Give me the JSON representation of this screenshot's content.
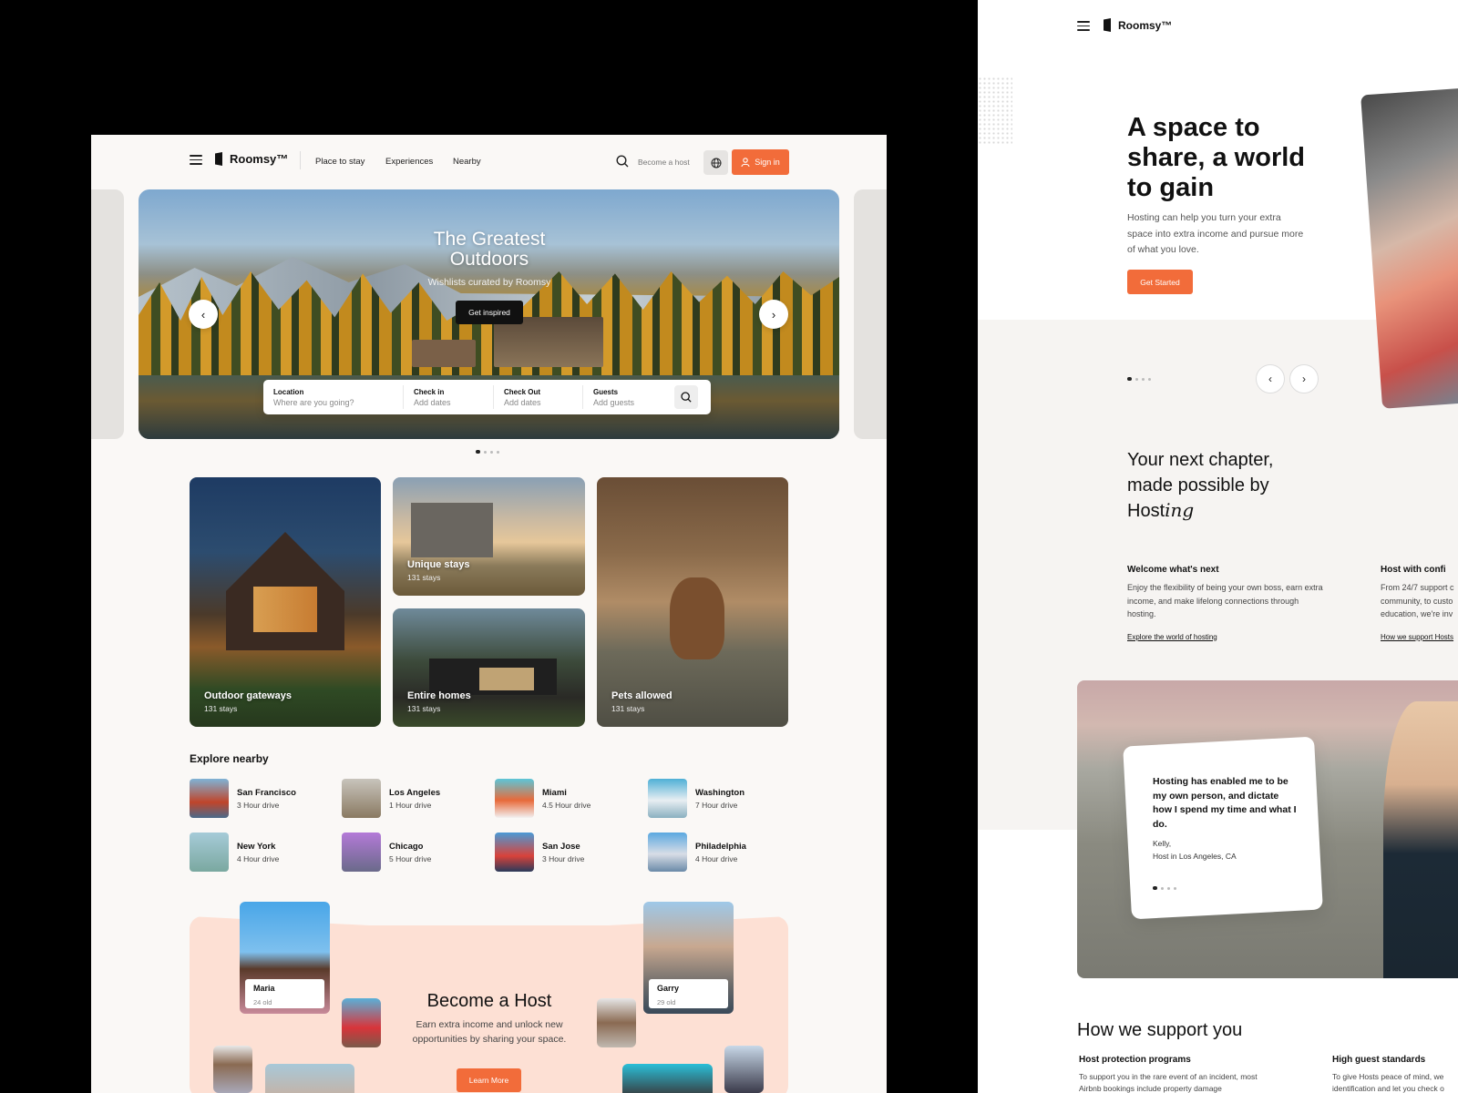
{
  "left": {
    "header": {
      "brand": "Roomsy™",
      "nav": [
        "Place to stay",
        "Experiences",
        "Nearby"
      ],
      "become_host": "Become a host",
      "sign_in": "Sign in"
    },
    "hero": {
      "title_line1": "The Greatest",
      "title_line2": "Outdoors",
      "subtitle": "Wishlists curated by Roomsy",
      "cta": "Get inspired",
      "prev_arrow": "‹",
      "next_arrow": "›",
      "search": {
        "location_label": "Location",
        "location_placeholder": "Where are you going?",
        "checkin_label": "Check in",
        "checkin_placeholder": "Add dates",
        "checkout_label": "Check Out",
        "checkout_placeholder": "Add dates",
        "guests_label": "Guests",
        "guests_placeholder": "Add guests"
      }
    },
    "categories": [
      {
        "title": "Outdoor gateways",
        "count": "131 stays"
      },
      {
        "title": "Unique stays",
        "count": "131 stays"
      },
      {
        "title": "Entire homes",
        "count": "131 stays"
      },
      {
        "title": "Pets allowed",
        "count": "131 stays"
      }
    ],
    "explore": {
      "title": "Explore nearby",
      "cities": [
        {
          "name": "San Francisco",
          "drive": "3 Hour drive"
        },
        {
          "name": "Los Angeles",
          "drive": "1 Hour drive"
        },
        {
          "name": "Miami",
          "drive": "4.5 Hour drive"
        },
        {
          "name": "Washington",
          "drive": "7 Hour drive"
        },
        {
          "name": "New York",
          "drive": "4 Hour drive"
        },
        {
          "name": "Chicago",
          "drive": "5 Hour drive"
        },
        {
          "name": "San Jose",
          "drive": "3 Hour drive"
        },
        {
          "name": "Philadelphia",
          "drive": "4 Hour drive"
        }
      ]
    },
    "host": {
      "title": "Become a Host",
      "body": "Earn extra income and unlock new opportunities by sharing your space.",
      "cta": "Learn More",
      "people": [
        {
          "name": "Maria",
          "age": "24 old"
        },
        {
          "name": "Garry",
          "age": "29 old"
        }
      ]
    }
  },
  "right": {
    "brand": "Roomsy™",
    "hero": {
      "title_line1": "A space to",
      "title_line2": "share, a world",
      "title_line3": "to gain",
      "body": "Hosting can help you turn your extra space into extra income and pursue more of what you love.",
      "cta": "Get Started",
      "prev_arrow": "‹",
      "next_arrow": "›"
    },
    "chapter": {
      "line1": "Your next chapter,",
      "line2": "made possible by",
      "line3_a": "Host",
      "line3_b": "ing"
    },
    "features": [
      {
        "title": "Welcome what's next",
        "body": "Enjoy the flexibility of being your own boss, earn extra income, and make lifelong connections through hosting.",
        "link": "Explore the world of hosting"
      },
      {
        "title": "Host with confi",
        "body": "From 24/7 support c community, to custo education, we're inv",
        "link": "How we support Hosts"
      }
    ],
    "testimonial": {
      "quote": "Hosting has enabled me to be my own person, and dictate how I spend my time and what I do.",
      "author": "Kelly,",
      "location": "Host in Los Angeles, CA"
    },
    "support": {
      "title": "How we support you",
      "items": [
        {
          "title": "Host protection programs",
          "body": "To support you in the rare event of an incident, most Airbnb bookings include property damage"
        },
        {
          "title": "High guest standards",
          "body": "To give Hosts peace of mind, we identification and let you check o"
        }
      ]
    }
  },
  "colors": {
    "accent": "#f26c3a",
    "hostbg": "#fde0d4",
    "page": "#faf8f6"
  }
}
